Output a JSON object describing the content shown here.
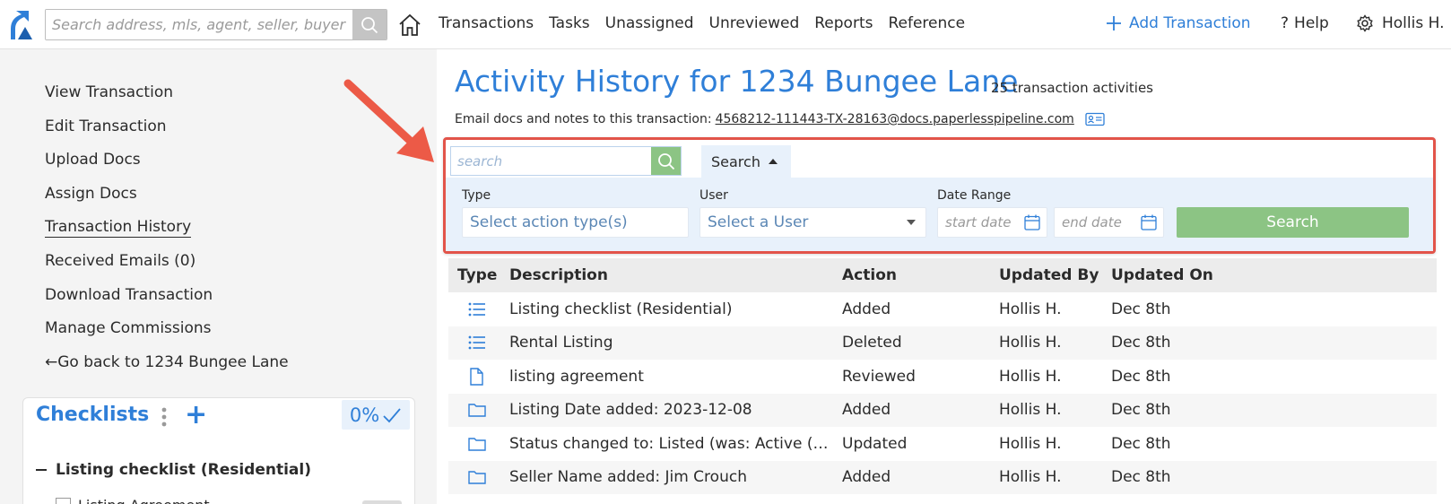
{
  "topnav": {
    "search_placeholder": "Search address, mls, agent, seller, buyer",
    "links": [
      "Transactions",
      "Tasks",
      "Unassigned",
      "Unreviewed",
      "Reports",
      "Reference"
    ],
    "add_transaction": "Add Transaction",
    "help": "Help",
    "user": "Hollis H.",
    "accent_color": "#2f7fd8"
  },
  "sidebar": {
    "items": [
      "View Transaction",
      "Edit Transaction",
      "Upload Docs",
      "Assign Docs",
      "Transaction History",
      "Received Emails (0)",
      "Download Transaction",
      "Manage Commissions",
      "Go back to 1234 Bungee Lane"
    ],
    "active_item": "Transaction History",
    "checklists": {
      "title": "Checklists",
      "percent": "0%",
      "list_name": "Listing checklist (Residential)",
      "first_item": "Listing Agreement"
    }
  },
  "main": {
    "title": "Activity History for 1234 Bungee Lane",
    "count": "25 transaction activities",
    "email_label": "Email docs and notes to this transaction:",
    "email_address": "4568212-111443-TX-28163@docs.paperlesspipeline.com",
    "filter": {
      "search_placeholder": "search",
      "toggle_label": "Search",
      "type_label": "Type",
      "type_placeholder": "Select action type(s)",
      "user_label": "User",
      "user_placeholder": "Select a User",
      "date_label": "Date Range",
      "start_placeholder": "start date",
      "end_placeholder": "end date",
      "submit_label": "Search",
      "highlight_color": "#e2544a"
    },
    "table": {
      "headers": [
        "Type",
        "Description",
        "Action",
        "Updated By",
        "Updated On"
      ],
      "rows": [
        {
          "icon": "list-icon",
          "description": "Listing checklist (Residential)",
          "action": "Added",
          "by": "Hollis H.",
          "on": "Dec 8th"
        },
        {
          "icon": "list-icon",
          "description": "Rental Listing",
          "action": "Deleted",
          "by": "Hollis H.",
          "on": "Dec 8th"
        },
        {
          "icon": "document-icon",
          "description": "listing agreement",
          "action": "Reviewed",
          "by": "Hollis H.",
          "on": "Dec 8th"
        },
        {
          "icon": "folder-icon",
          "description": "Listing Date added: 2023-12-08",
          "action": "Added",
          "by": "Hollis H.",
          "on": "Dec 8th"
        },
        {
          "icon": "folder-icon",
          "description": "Status changed to: Listed (was: Active (Under Contract))",
          "action": "Updated",
          "by": "Hollis H.",
          "on": "Dec 8th"
        },
        {
          "icon": "folder-icon",
          "description": "Seller Name added: Jim Crouch",
          "action": "Added",
          "by": "Hollis H.",
          "on": "Dec 8th"
        }
      ]
    }
  }
}
